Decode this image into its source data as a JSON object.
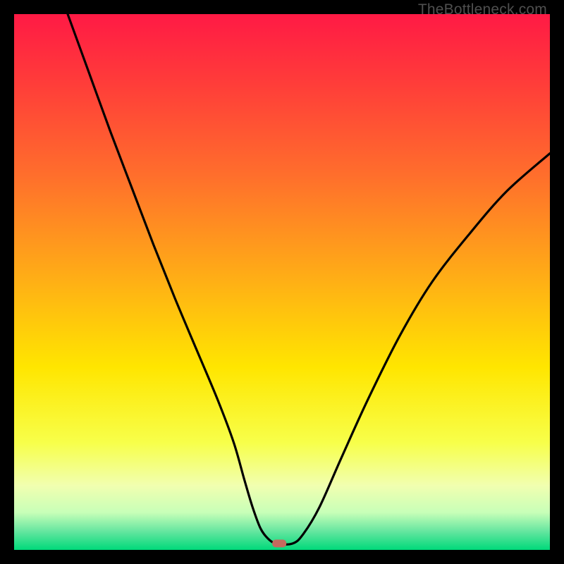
{
  "watermark": "TheBottleneck.com",
  "chart_data": {
    "type": "line",
    "title": "",
    "xlabel": "",
    "ylabel": "",
    "xlim": [
      0,
      100
    ],
    "ylim": [
      0,
      100
    ],
    "background_gradient": {
      "stops": [
        {
          "offset": 0.0,
          "color": "#ff1a45"
        },
        {
          "offset": 0.12,
          "color": "#ff3a3a"
        },
        {
          "offset": 0.3,
          "color": "#ff6e2c"
        },
        {
          "offset": 0.5,
          "color": "#ffb015"
        },
        {
          "offset": 0.66,
          "color": "#ffe600"
        },
        {
          "offset": 0.8,
          "color": "#f7ff4a"
        },
        {
          "offset": 0.88,
          "color": "#f1ffb0"
        },
        {
          "offset": 0.93,
          "color": "#c8ffb8"
        },
        {
          "offset": 0.965,
          "color": "#66e6a0"
        },
        {
          "offset": 1.0,
          "color": "#00d97a"
        }
      ]
    },
    "series": [
      {
        "name": "bottleneck-curve",
        "color": "#000000",
        "x": [
          10,
          14,
          18,
          22,
          26,
          30,
          34,
          38,
          41,
          43,
          44.5,
          46,
          47.5,
          49,
          52,
          54,
          57,
          61,
          66,
          72,
          78,
          85,
          92,
          100
        ],
        "y": [
          100,
          89,
          78,
          67.5,
          57,
          47,
          37.5,
          28,
          20,
          13,
          8,
          4,
          2,
          1.2,
          1.2,
          3,
          8,
          17,
          28,
          40,
          50,
          59,
          67,
          74
        ]
      }
    ],
    "marker": {
      "name": "optimal-marker",
      "x": 49.5,
      "y": 1.2,
      "color": "#c46a5e"
    }
  }
}
